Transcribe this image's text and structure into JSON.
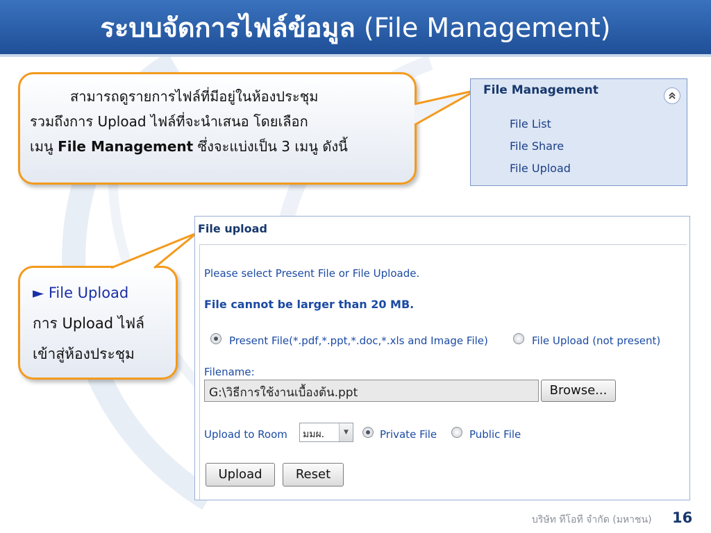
{
  "slide": {
    "title_thai": "ระบบจัดการไฟล์ข้อมูล",
    "title_en": "(File Management)",
    "company": "บริษัท ทีโอที จำกัด (มหาชน)",
    "page_number": "16"
  },
  "callout_top": {
    "line1": "สามารถดูรายการไฟล์ที่มีอยู่ในห้องประชุม",
    "line2": "รวมถึงการ Upload ไฟล์ที่จะนำเสนอ  โดยเลือก",
    "line3_prefix": "เมนู",
    "line3_bold": "File Management",
    "line3_suffix": "ซึ่งจะแบ่งเป็น  3 เมนู ดังนี้"
  },
  "callout_left": {
    "marker": "►",
    "title": "File Upload",
    "line2": "การ Upload ไฟล์",
    "line3": "เข้าสู่ห้องประชุม"
  },
  "file_management_menu": {
    "heading": "File Management",
    "collapse_icon": "double-chevron-up-icon",
    "items": [
      "File List",
      "File Share",
      "File Upload"
    ]
  },
  "file_upload_form": {
    "heading": "File upload",
    "instruction": "Please select Present File or File Uploade.",
    "size_limit": "File cannot be larger than 20 MB.",
    "mode_options": [
      {
        "label": "Present File(*.pdf,*.ppt,*.doc,*.xls and Image File)",
        "selected": true
      },
      {
        "label": "File Upload (not present)",
        "selected": false
      }
    ],
    "filename_label": "Filename:",
    "filename_value": "G:\\วิธีการใช้งานเบื้องต้น.ppt",
    "browse_label": "Browse...",
    "room_label": "Upload to Room",
    "room_value": "มมผ.",
    "visibility_options": [
      {
        "label": "Private File",
        "selected": true
      },
      {
        "label": "Public File",
        "selected": false
      }
    ],
    "upload_button": "Upload",
    "reset_button": "Reset"
  },
  "colors": {
    "title_bar": "#2a5ea9",
    "callout_border": "#f39a1d",
    "panel_background": "#dde6f4",
    "link_blue": "#1b3f86",
    "form_text_blue": "#1b4aa3"
  }
}
